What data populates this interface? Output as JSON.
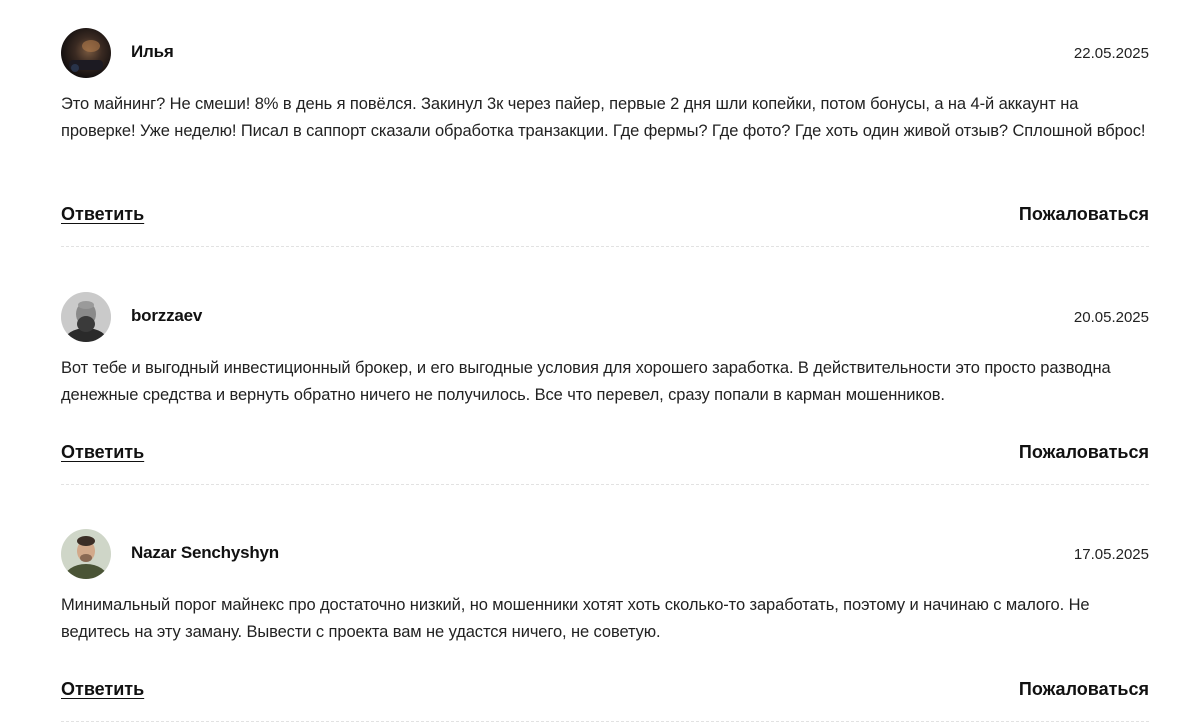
{
  "comments": [
    {
      "author": "Илья",
      "date": "22.05.2025",
      "text": "Это майнинг? Не смеши! 8% в день я повёлся. Закинул 3к через пайер, первые 2 дня шли копейки, потом бонусы, а на 4-й аккаунт на проверке! Уже неделю! Писал в саппорт сказали обработка транзакции. Где фермы? Где фото? Где хоть один живой отзыв? Сплошной вброс!",
      "reply_label": "Ответить",
      "report_label": "Пожаловаться",
      "avatar": "dark-photo-avatar"
    },
    {
      "author": "borzzaev",
      "date": "20.05.2025",
      "text": "Вот тебе и выгодный инвестиционный брокер, и его выгодные условия для хорошего заработка. В действительности это просто разводна денежные средства и вернуть обратно ничего не получилось. Все что перевел, сразу попали в карман мошенников.",
      "reply_label": "Ответить",
      "report_label": "Пожаловаться",
      "avatar": "bearded-man-avatar"
    },
    {
      "author": "Nazar Senchyshyn",
      "date": "17.05.2025",
      "text": "Минимальный порог майнекс про достаточно низкий, но мошенники хотят хоть сколько-то заработать, поэтому и начинаю с малого. Не ведитесь на эту заману. Вывести с проекта вам не удастся ничего, не советую.",
      "reply_label": "Ответить",
      "report_label": "Пожаловаться",
      "avatar": "man-portrait-avatar"
    }
  ],
  "colors": {
    "text": "#111111",
    "divider": "#e2e2e2",
    "background": "#ffffff"
  }
}
